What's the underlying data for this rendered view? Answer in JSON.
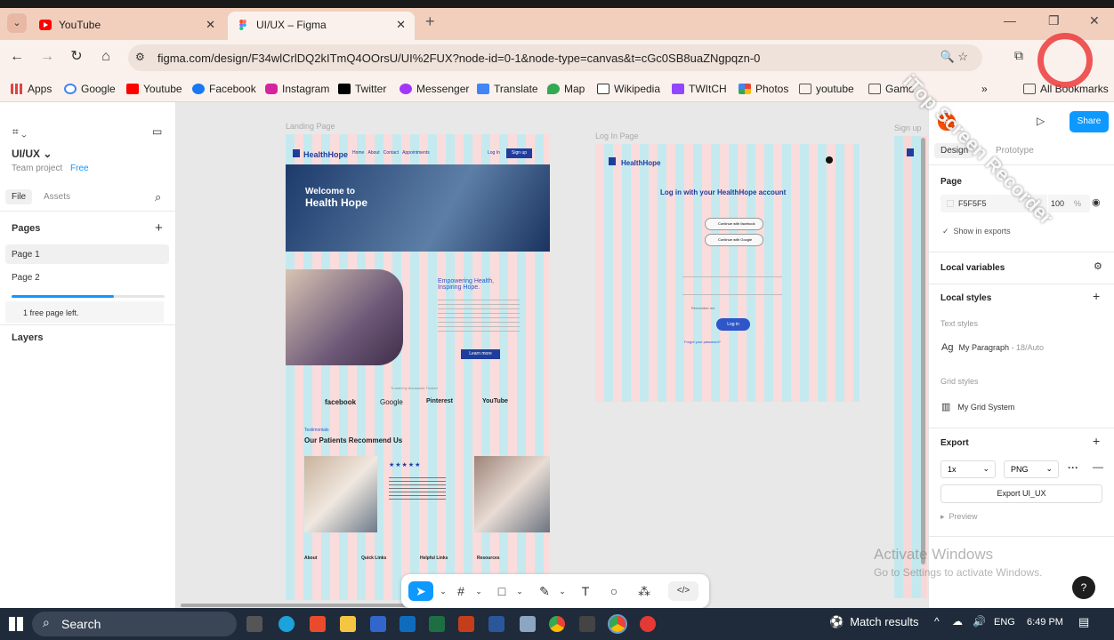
{
  "browser": {
    "tabs": [
      {
        "title": "YouTube",
        "favicon": "youtube-icon"
      },
      {
        "title": "UI/UX – Figma",
        "favicon": "figma-icon",
        "active": true
      }
    ],
    "url": "figma.com/design/F34wlCrlDQ2kITmQ4OOrsU/UI%2FUX?node-id=0-1&node-type=canvas&t=cGc0SB8uaZNgpqzn-0",
    "bookmarks": [
      "Apps",
      "Google",
      "Youtube",
      "Facebook",
      "Instagram",
      "Twitter",
      "Messenger",
      "Translate",
      "Map",
      "Wikipedia",
      "TWItCH",
      "Photos",
      "youtube",
      "Game"
    ],
    "all_bookmarks": "All Bookmarks"
  },
  "left_panel": {
    "file_name": "UI/UX",
    "team": "Team project",
    "plan": "Free",
    "tabs": [
      "File",
      "Assets"
    ],
    "pages_header": "Pages",
    "pages": [
      "Page 1",
      "Page 2"
    ],
    "free_pages": "1 free page left.",
    "layers_header": "Layers",
    "pages_used_fraction": 0.67
  },
  "canvas": {
    "landing": {
      "label": "Landing Page",
      "brand": "HealthHope",
      "nav": [
        "Home",
        "About",
        "Contact",
        "Appointments"
      ],
      "login": "Log In",
      "signup": "Sign up",
      "hero": "Welcome to Health Hope",
      "hero_line1": "Welcome to",
      "hero_line2": "Health Hope",
      "section_title": "Empowering Health, Inspiring Hope.",
      "section_title1": "Empowering Health,",
      "section_title2": "Inspiring Hope.",
      "learn_more": "Learn more",
      "partners_caption": "Trusted by thousands Trusted",
      "partners": [
        "facebook",
        "Google",
        "Pinterest",
        "YouTube"
      ],
      "testimonials_label": "Testimonials",
      "testimonials_title": "Our Patients Recommend Us",
      "stars": "★★★★★",
      "footer_cols": [
        "About",
        "Quick Links",
        "Helpful Links",
        "Resources"
      ]
    },
    "login": {
      "label": "Log In Page",
      "brand": "HealthHope",
      "title": "Log in with your HealthHope account",
      "facebook_btn": "Continue with facebook",
      "google_btn": "Continue with Google",
      "login_btn": "Log in",
      "remember": "Remember me",
      "forgot": "Forgot your password?"
    },
    "signup_label": "Sign up"
  },
  "right_panel": {
    "share": "Share",
    "tabs": [
      "Design",
      "Prototype"
    ],
    "page_header": "Page",
    "page_color": "F5F5F5",
    "page_opacity": "100",
    "percent": "%",
    "show_exports": "Show in exports",
    "local_variables": "Local variables",
    "local_styles": "Local styles",
    "text_styles": "Text styles",
    "paragraph_style": "My Paragraph",
    "paragraph_meta": "18/Auto",
    "grid_styles": "Grid styles",
    "grid_system": "My Grid System",
    "export_header": "Export",
    "export_scale": "1x",
    "export_format": "PNG",
    "export_button": "Export UI_UX",
    "preview": "Preview",
    "help": "?"
  },
  "overlays": {
    "activate_title": "Activate Windows",
    "activate_sub": "Go to Settings to activate Windows.",
    "recorder": "iTop Screen Recorder"
  },
  "taskbar": {
    "search": "Search",
    "match_results": "Match results",
    "language": "ENG",
    "time": "6:49 PM"
  },
  "colors": {
    "figma_blue": "#0d99ff",
    "brand_navy": "#1f3d9c",
    "grid_red": "#ff6e6e",
    "grid_cyan": "#bfe9ef"
  }
}
